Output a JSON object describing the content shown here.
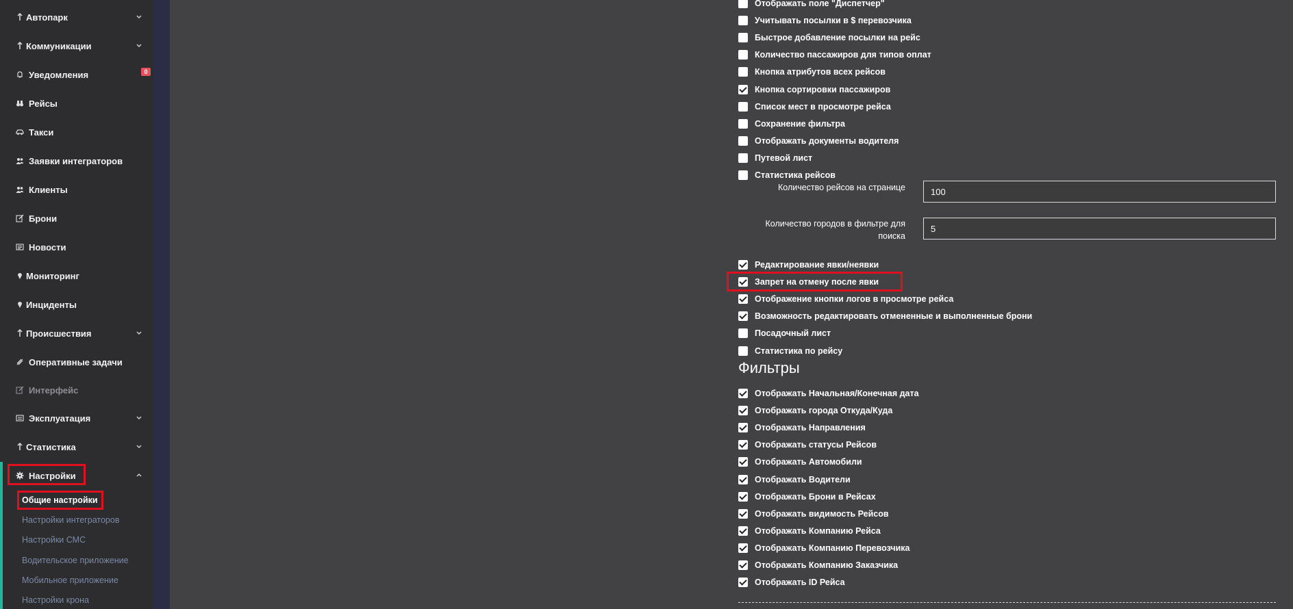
{
  "sidebar": {
    "items": [
      {
        "label": "Автопарк",
        "icon": "arrow-up-icon",
        "chevron": "down"
      },
      {
        "label": "Коммуникации",
        "icon": "arrow-up-icon",
        "chevron": "down"
      },
      {
        "label": "Уведомления",
        "icon": "bell-icon",
        "badge": "0"
      },
      {
        "label": "Рейсы",
        "icon": "binoculars-icon"
      },
      {
        "label": "Такси",
        "icon": "car-icon"
      },
      {
        "label": "Заявки интеграторов",
        "icon": "users-icon"
      },
      {
        "label": "Клиенты",
        "icon": "users-icon"
      },
      {
        "label": "Брони",
        "icon": "edit-icon"
      },
      {
        "label": "Новости",
        "icon": "newspaper-icon"
      },
      {
        "label": "Мониторинг",
        "icon": "map-pin-icon"
      },
      {
        "label": "Инциденты",
        "icon": "map-pin-icon"
      },
      {
        "label": "Происшествия",
        "icon": "arrow-up-icon",
        "chevron": "down"
      },
      {
        "label": "Оперативные задачи",
        "icon": "tasks-icon"
      },
      {
        "label": "Интерфейс",
        "icon": "edit-icon"
      },
      {
        "label": "Эксплуатация",
        "icon": "list-icon",
        "chevron": "down"
      },
      {
        "label": "Статистика",
        "icon": "arrow-up-icon",
        "chevron": "down"
      },
      {
        "label": "Настройки",
        "icon": "gear-icon",
        "chevron": "up"
      }
    ],
    "sub_items": [
      "Общие настройки",
      "Настройки интеграторов",
      "Настройки СМС",
      "Водительское приложение",
      "Мобильное приложение",
      "Настройки крона"
    ]
  },
  "settings_top": [
    {
      "label": "Отображать поле \"Диспетчер\"",
      "checked": false
    },
    {
      "label": "Учитывать посылки в $ перевозчика",
      "checked": false
    },
    {
      "label": "Быстрое добавление посылки на рейс",
      "checked": false
    },
    {
      "label": "Количество пассажиров для типов оплат",
      "checked": false
    },
    {
      "label": "Кнопка атрибутов всех рейсов",
      "checked": false
    },
    {
      "label": "Кнопка сортировки пассажиров",
      "checked": true
    },
    {
      "label": "Список мест в просмотре рейса",
      "checked": false
    },
    {
      "label": "Сохранение фильтра",
      "checked": false
    },
    {
      "label": "Отображать документы водителя",
      "checked": false
    },
    {
      "label": "Путевой лист",
      "checked": false
    },
    {
      "label": "Статистика рейсов",
      "checked": false
    }
  ],
  "fields": [
    {
      "label": "Количество рейсов на странице",
      "value": "100"
    },
    {
      "label": "Количество городов в фильтре для поиска",
      "value": "5"
    }
  ],
  "settings_bottom": [
    {
      "label": "Редактирование явки/неявки",
      "checked": true
    },
    {
      "label": "Запрет на отмену после явки",
      "checked": true
    },
    {
      "label": "Отображение кнопки логов в просмотре рейса",
      "checked": true
    },
    {
      "label": "Возможность редактировать отмененные и выполненные брони",
      "checked": true
    },
    {
      "label": "Посадочный лист",
      "checked": false
    },
    {
      "label": "Статистика по рейсу",
      "checked": false
    }
  ],
  "filters_title": "Фильтры",
  "filters": [
    {
      "label": "Отображать Начальная/Конечная дата",
      "checked": true
    },
    {
      "label": "Отображать города Откуда/Куда",
      "checked": true
    },
    {
      "label": "Отображать Направления",
      "checked": true
    },
    {
      "label": "Отображать статусы Рейсов",
      "checked": true
    },
    {
      "label": "Отображать Автомобили",
      "checked": true
    },
    {
      "label": "Отображать Водители",
      "checked": true
    },
    {
      "label": "Отображать Брони в Рейсах",
      "checked": true
    },
    {
      "label": "Отображать видимость Рейсов",
      "checked": true
    },
    {
      "label": "Отображать Компанию Рейса",
      "checked": true
    },
    {
      "label": "Отображать Компанию Перевозчика",
      "checked": true
    },
    {
      "label": "Отображать Компанию Заказчика",
      "checked": true
    },
    {
      "label": "Отображать ID Рейса",
      "checked": true
    }
  ]
}
